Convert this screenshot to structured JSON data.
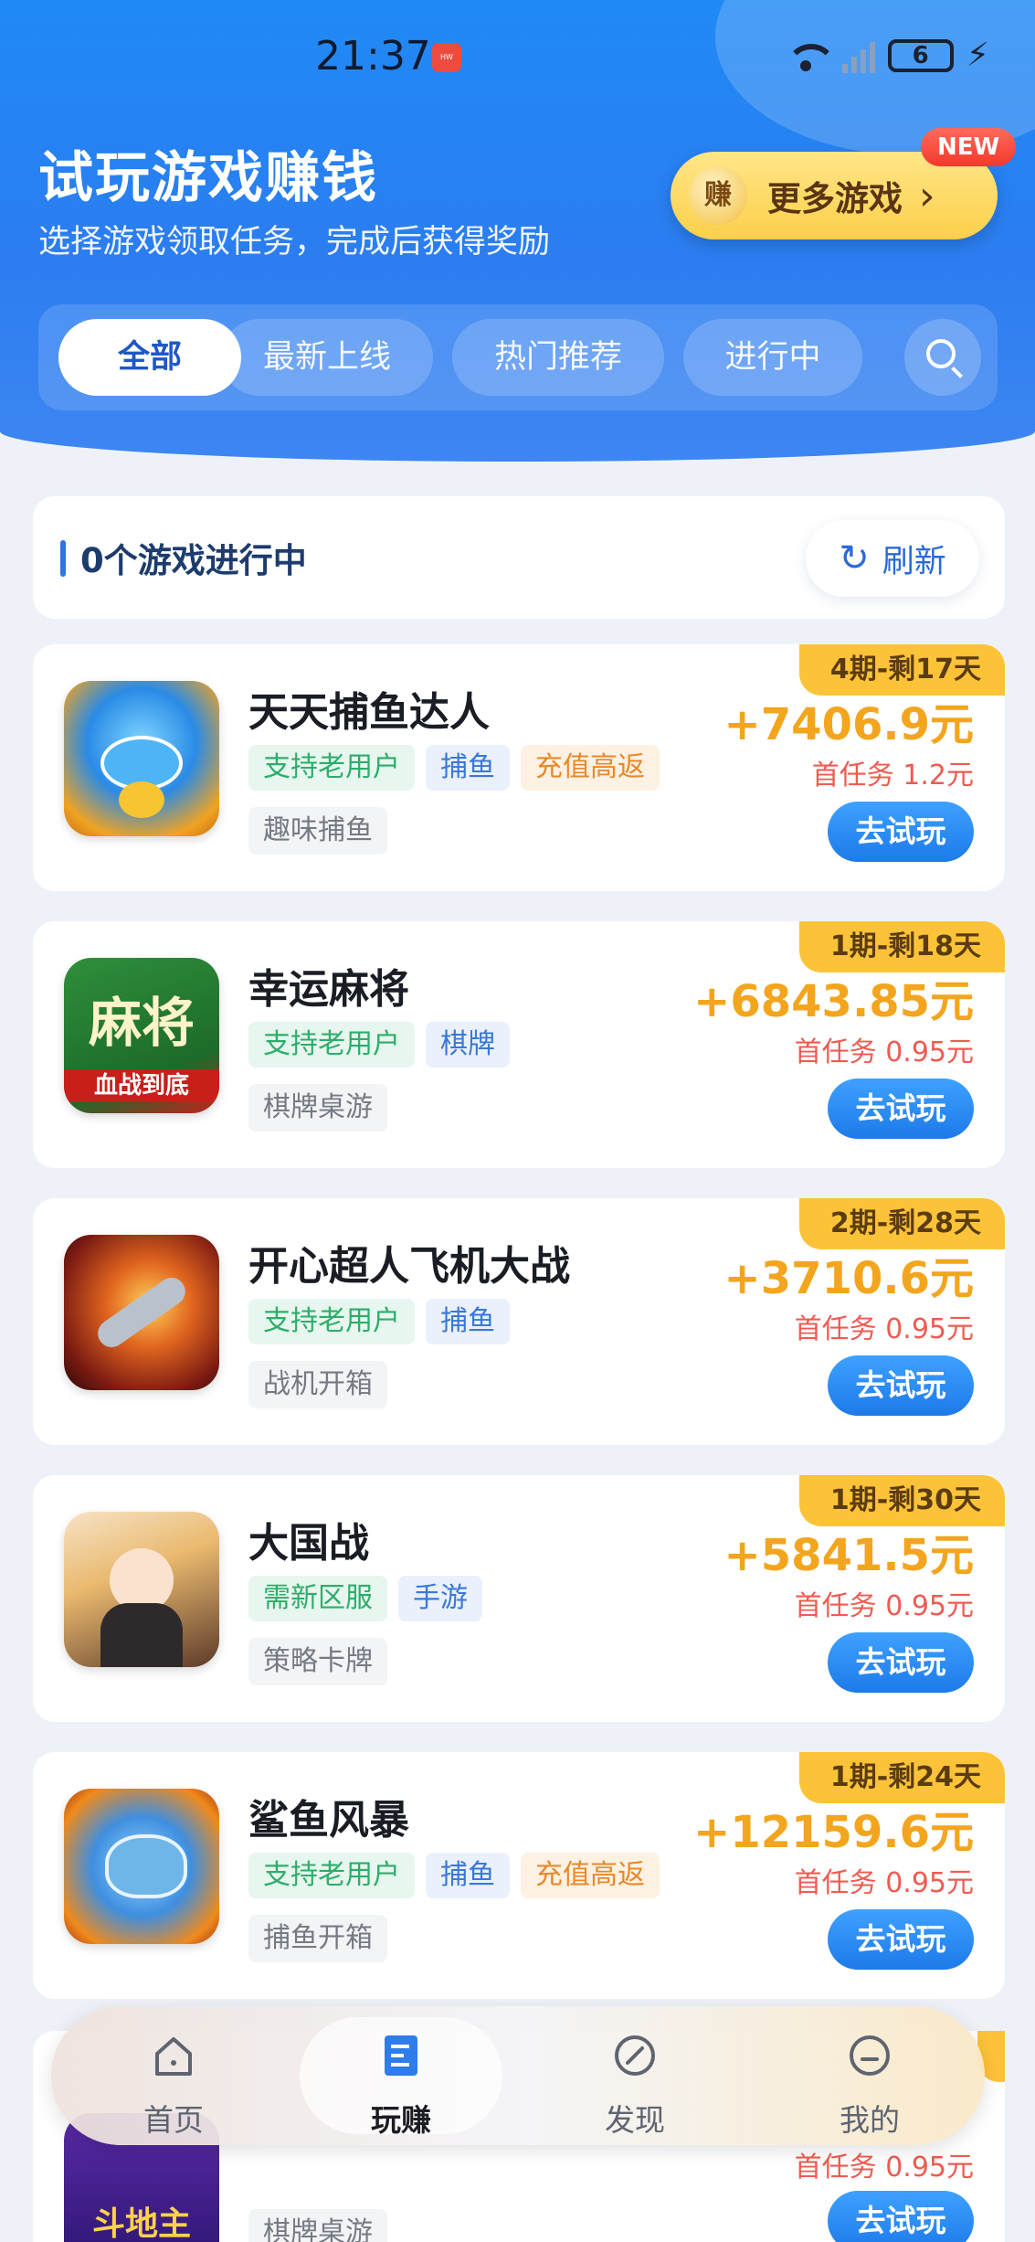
{
  "status_bar": {
    "time": "21:37",
    "battery": "6"
  },
  "header": {
    "title": "试玩游戏赚钱",
    "subtitle": "选择游戏领取任务，完成后获得奖励",
    "more_games": {
      "icon_text": "赚",
      "label": "更多游戏",
      "badge": "NEW"
    }
  },
  "filters": [
    "全部",
    "最新上线",
    "热门推荐",
    "进行中"
  ],
  "progress": {
    "text": "0个游戏进行中",
    "refresh_label": "刷新"
  },
  "games": [
    {
      "title": "天天捕鱼达人",
      "tags": [
        "支持老用户",
        "捕鱼",
        "充值高返"
      ],
      "genre": "趣味捕鱼",
      "period": "4期-剩17天",
      "reward": "+7406.9元",
      "first_task": "首任务 1.2元",
      "button": "去试玩"
    },
    {
      "title": "幸运麻将",
      "tags": [
        "支持老用户",
        "棋牌"
      ],
      "genre": "棋牌桌游",
      "period": "1期-剩18天",
      "reward": "+6843.85元",
      "first_task": "首任务 0.95元",
      "button": "去试玩"
    },
    {
      "title": "开心超人飞机大战",
      "tags": [
        "支持老用户",
        "捕鱼"
      ],
      "genre": "战机开箱",
      "period": "2期-剩28天",
      "reward": "+3710.6元",
      "first_task": "首任务 0.95元",
      "button": "去试玩"
    },
    {
      "title": "大国战",
      "tags": [
        "需新区服",
        "手游"
      ],
      "genre": "策略卡牌",
      "period": "1期-剩30天",
      "reward": "+5841.5元",
      "first_task": "首任务 0.95元",
      "button": "去试玩"
    },
    {
      "title": "鲨鱼风暴",
      "tags": [
        "支持老用户",
        "捕鱼",
        "充值高返"
      ],
      "genre": "捕鱼开箱",
      "period": "1期-剩24天",
      "reward": "+12159.6元",
      "first_task": "首任务 0.95元",
      "button": "去试玩"
    }
  ],
  "peek_card": {
    "genre": "棋牌桌游",
    "button": "去试玩",
    "first_task": "首任务 0.95元",
    "icon_text": "斗地主"
  },
  "mahjong_icon_text": {
    "top": "麻将",
    "bottom": "血战到底"
  },
  "bottom_nav": [
    "首页",
    "玩赚",
    "发现",
    "我的"
  ],
  "colors": {
    "primary": "#2b7df0",
    "reward": "#f3a51d",
    "tag_green": "#2cae6a",
    "tag_blue": "#3a78d6",
    "tag_orange": "#e7892b"
  }
}
